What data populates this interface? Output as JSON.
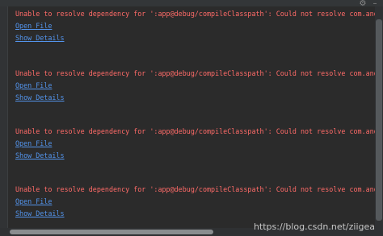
{
  "console": {
    "entries": [
      {
        "message": "Unable to resolve dependency for ':app@debug/compileClasspath': Could not resolve com.android.suppo",
        "open_file": "Open File",
        "show_details": "Show Details"
      },
      {
        "message": "Unable to resolve dependency for ':app@debug/compileClasspath': Could not resolve com.android.suppo",
        "open_file": "Open File",
        "show_details": "Show Details"
      },
      {
        "message": "Unable to resolve dependency for ':app@debug/compileClasspath': Could not resolve com.android.suppo",
        "open_file": "Open File",
        "show_details": "Show Details"
      },
      {
        "message": "Unable to resolve dependency for ':app@debug/compileClasspath': Could not resolve com.android.suppo",
        "open_file": "Open File",
        "show_details": "Show Details"
      }
    ]
  },
  "toolbar": {
    "settings_icon": "gear-icon",
    "collapse_icon": "minimize-icon"
  },
  "watermark": "https://blog.csdn.net/ziigea",
  "colors": {
    "background": "#2b2b2b",
    "error_text": "#ff6b68",
    "link_text": "#5394ec"
  }
}
